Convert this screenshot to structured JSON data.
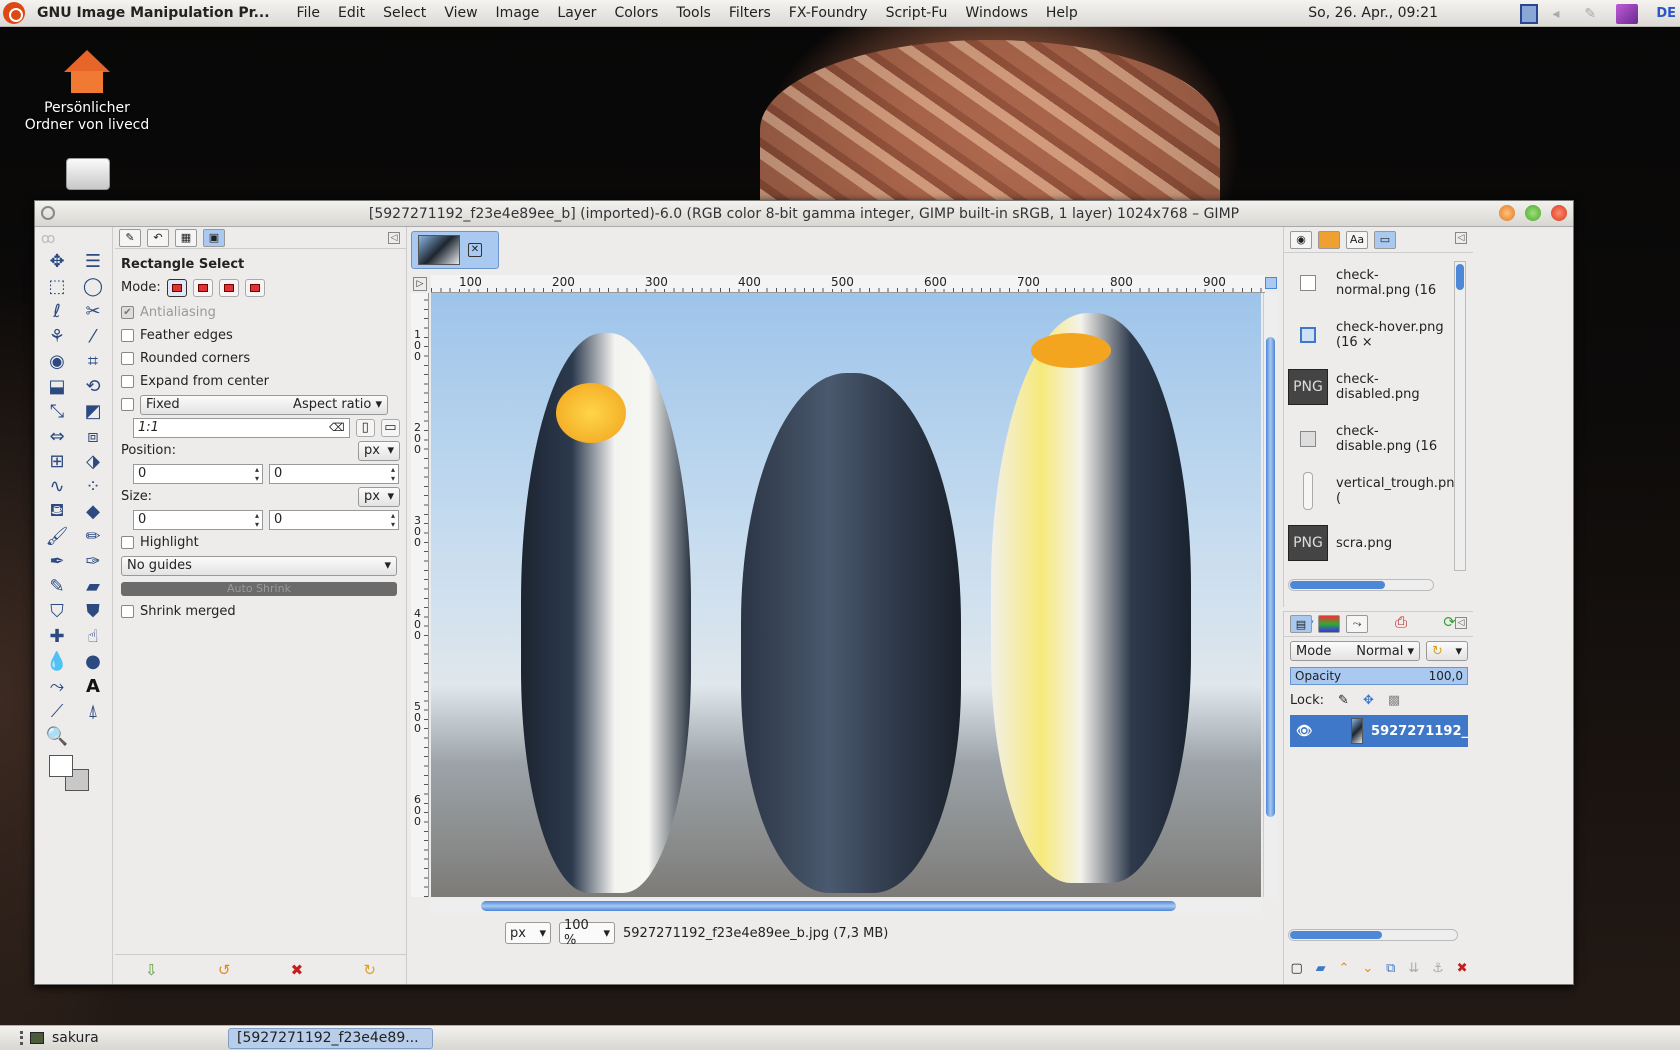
{
  "topbar": {
    "app_name": "GNU Image Manipulation Pr...",
    "menu": [
      "File",
      "Edit",
      "Select",
      "View",
      "Image",
      "Layer",
      "Colors",
      "Tools",
      "Filters",
      "FX-Foundry",
      "Script-Fu",
      "Windows",
      "Help"
    ],
    "clock": "So, 26. Apr., 09:21",
    "lang": "DE"
  },
  "desktop": {
    "home_label_1": "Persönlicher",
    "home_label_2": "Ordner von livecd"
  },
  "window": {
    "title": "[5927271192_f23e4e89ee_b] (imported)-6.0 (RGB color 8-bit gamma integer, GIMP built-in sRGB, 1 layer) 1024x768 – GIMP"
  },
  "tool_options": {
    "title": "Rectangle Select",
    "mode_label": "Mode:",
    "antialiasing": "Antialiasing",
    "feather": "Feather edges",
    "rounded": "Rounded corners",
    "expand": "Expand from center",
    "fixed": "Fixed",
    "fixed_mode": "Aspect ratio",
    "ratio": "1:1",
    "position_label": "Position:",
    "size_label": "Size:",
    "unit": "px",
    "pos_x": "0",
    "pos_y": "0",
    "size_w": "0",
    "size_h": "0",
    "highlight": "Highlight",
    "guides": "No guides",
    "auto_shrink": "Auto Shrink",
    "shrink_merged": "Shrink merged"
  },
  "canvas": {
    "ruler_h": [
      "100",
      "200",
      "300",
      "400",
      "500",
      "600",
      "700",
      "800",
      "900"
    ],
    "ruler_v": [
      "100",
      "200",
      "300",
      "400",
      "500",
      "600"
    ],
    "unit": "px",
    "zoom": "100 %",
    "status": "5927271192_f23e4e89ee_b.jpg (7,3 MB)"
  },
  "brushes": {
    "items": [
      "check-normal.png (16",
      "check-hover.png (16 ×",
      "check-disabled.png",
      "check-disable.png (16",
      "vertical_trough.png (",
      "scra.png"
    ],
    "png_label": "PNG"
  },
  "layers": {
    "mode_label": "Mode",
    "mode_value": "Normal",
    "opacity_label": "Opacity",
    "opacity_value": "100,0",
    "lock_label": "Lock:",
    "layer_name": "5927271192_"
  },
  "taskbar": {
    "user": "sakura",
    "task": "[5927271192_f23e4e89..."
  },
  "colors": {
    "accent": "#3f78c8",
    "selection": "#a9c9f0"
  }
}
